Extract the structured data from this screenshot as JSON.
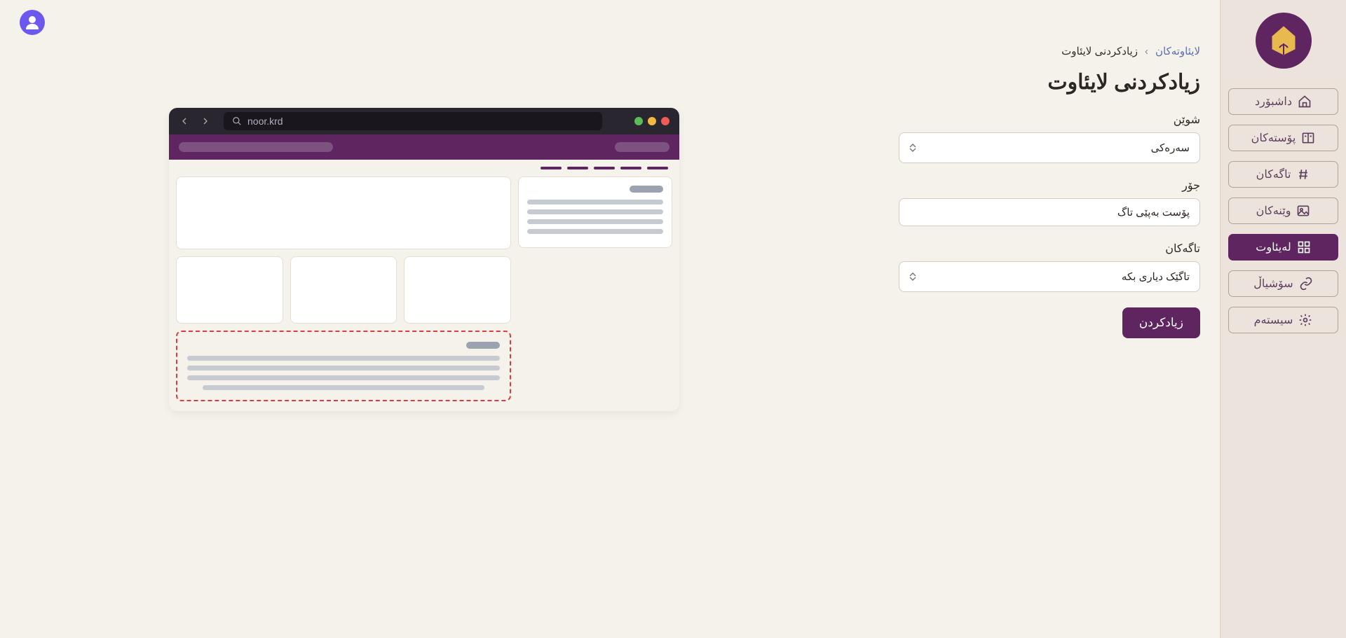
{
  "sidebar": {
    "items": [
      {
        "label": "داشبۆرد",
        "icon": "home"
      },
      {
        "label": "پۆستەکان",
        "icon": "book"
      },
      {
        "label": "تاگەکان",
        "icon": "hash"
      },
      {
        "label": "وێنەکان",
        "icon": "image"
      },
      {
        "label": "لەیئاوت",
        "icon": "layout"
      },
      {
        "label": "سۆشیاڵ",
        "icon": "link"
      },
      {
        "label": "سیستەم",
        "icon": "gear"
      }
    ]
  },
  "breadcrumb": {
    "parent": "لایئاوتەکان",
    "current": "زیادکردنی لایئاوت"
  },
  "page_title": "زیادکردنی لایئاوت",
  "form": {
    "place_label": "شوێن",
    "place_value": "سەرەکی",
    "type_label": "جۆر",
    "type_value": "پۆست بەپێی تاگ",
    "tags_label": "تاگەکان",
    "tags_value": "تاگێک دیاری بکە",
    "submit": "زیادکردن"
  },
  "preview": {
    "address": "noor.krd"
  }
}
